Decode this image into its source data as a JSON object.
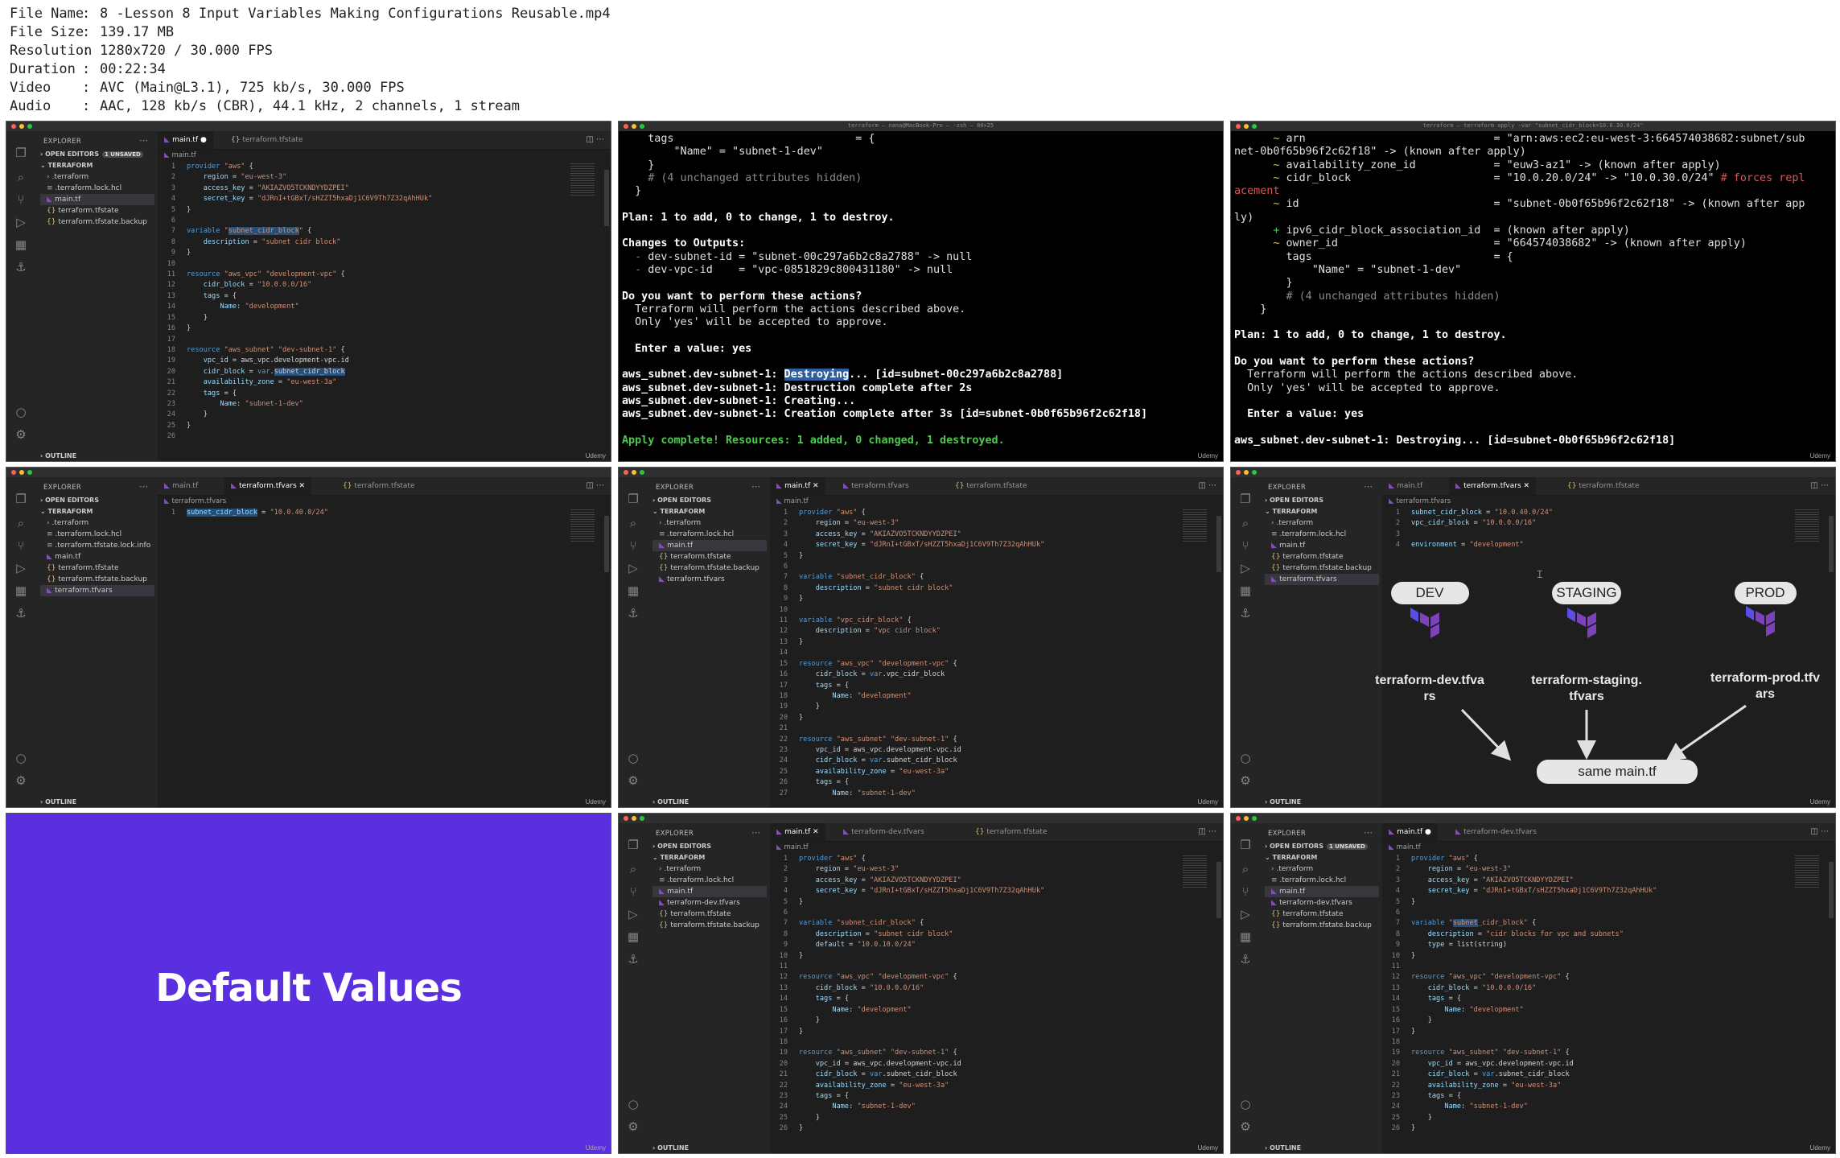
{
  "meta": [
    {
      "key": "File Name",
      "value": "8 -Lesson 8 Input Variables Making Configurations Reusable.mp4"
    },
    {
      "key": "File Size",
      "value": "139.17 MB"
    },
    {
      "key": "Resolution",
      "value": "1280x720 / 30.000 FPS"
    },
    {
      "key": "Duration",
      "value": "00:22:34"
    },
    {
      "key": "Video",
      "value": "AVC (Main@L3.1), 725 kb/s, 30.000 FPS"
    },
    {
      "key": "Audio",
      "value": "AAC, 128 kb/s (CBR), 44.1 kHz, 2 channels, 1 stream"
    }
  ],
  "watermark": "Udemy",
  "sidebar": {
    "explorer": "EXPLORER",
    "open_editors": "OPEN EDITORS",
    "unsaved": "1 UNSAVED",
    "project": "TERRAFORM",
    "outline": "OUTLINE"
  },
  "tile1": {
    "tabs": [
      "main.tf",
      "terraform.tfstate"
    ],
    "crumb": "main.tf",
    "files": [
      ".terraform",
      ".terraform.lock.hcl",
      "main.tf",
      "terraform.tfstate",
      "terraform.tfstate.backup"
    ],
    "code": [
      "provider \"aws\" {",
      "    region = \"eu-west-3\"",
      "    access_key = \"AKIAZVO5TCKNDYYDZPEI\"",
      "    secret_key = \"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\"",
      "}",
      "",
      "variable \"subnet_cidr_block\" {",
      "    description = \"subnet cidr block\"",
      "}",
      "",
      "resource \"aws_vpc\" \"development-vpc\" {",
      "    cidr_block = \"10.0.0.0/16\"",
      "    tags = {",
      "        Name: \"development\"",
      "    }",
      "}",
      "",
      "resource \"aws_subnet\" \"dev-subnet-1\" {",
      "    vpc_id = aws_vpc.development-vpc.id",
      "    cidr_block = var.subnet_cidr_block",
      "    availability_zone = \"eu-west-3a\"",
      "    tags = {",
      "        Name: \"subnet-1-dev\"",
      "    }",
      "}",
      ""
    ]
  },
  "tile2": {
    "title": "terraform — nana@MacBook-Pro — -zsh — 80×25",
    "lines": [
      "    tags                            = {",
      "        \"Name\" = \"subnet-1-dev\"",
      "    }",
      "    # (4 unchanged attributes hidden)",
      "  }",
      "",
      "Plan: 1 to add, 0 to change, 1 to destroy.",
      "",
      "Changes to Outputs:",
      "  - dev-subnet-id = \"subnet-00c297a6b2c8a2788\" -> null",
      "  - dev-vpc-id    = \"vpc-0851829c800431180\" -> null",
      "",
      "Do you want to perform these actions?",
      "  Terraform will perform the actions described above.",
      "  Only 'yes' will be accepted to approve.",
      "",
      "  Enter a value: yes",
      "",
      "aws_subnet.dev-subnet-1: Destroying... [id=subnet-00c297a6b2c8a2788]",
      "aws_subnet.dev-subnet-1: Destruction complete after 2s",
      "aws_subnet.dev-subnet-1: Creating...",
      "aws_subnet.dev-subnet-1: Creation complete after 3s [id=subnet-0b0f65b96f2c62f18]",
      "",
      "Apply complete! Resources: 1 added, 0 changed, 1 destroyed."
    ]
  },
  "tile3": {
    "title": "terraform — terraform apply -var \"subnet_cidr_block=10.0.30.0/24\"",
    "lines": [
      "      ~ arn                             = \"arn:aws:ec2:eu-west-3:664574038682:subnet/sub",
      "net-0b0f65b96f2c62f18\" -> (known after apply)",
      "      ~ availability_zone_id            = \"euw3-az1\" -> (known after apply)",
      "      ~ cidr_block                      = \"10.0.20.0/24\" -> \"10.0.30.0/24\" # forces repl",
      "acement",
      "      ~ id                              = \"subnet-0b0f65b96f2c62f18\" -> (known after app",
      "ly)",
      "      + ipv6_cidr_block_association_id  = (known after apply)",
      "      ~ owner_id                        = \"664574038682\" -> (known after apply)",
      "        tags                            = {",
      "            \"Name\" = \"subnet-1-dev\"",
      "        }",
      "        # (4 unchanged attributes hidden)",
      "    }",
      "",
      "Plan: 1 to add, 0 to change, 1 to destroy.",
      "",
      "Do you want to perform these actions?",
      "  Terraform will perform the actions described above.",
      "  Only 'yes' will be accepted to approve.",
      "",
      "  Enter a value: yes",
      "",
      "aws_subnet.dev-subnet-1: Destroying... [id=subnet-0b0f65b96f2c62f18]"
    ]
  },
  "tile4": {
    "tabs": [
      "main.tf",
      "terraform.tfvars",
      "terraform.tfstate"
    ],
    "crumb": "terraform.tfvars",
    "files": [
      ".terraform",
      ".terraform.lock.hcl",
      ".terraform.tfstate.lock.info",
      "main.tf",
      "terraform.tfstate",
      "terraform.tfstate.backup",
      "terraform.tfvars"
    ],
    "code": [
      "subnet_cidr_block = \"10.0.40.0/24\""
    ]
  },
  "tile5": {
    "tabs": [
      "main.tf",
      "terraform.tfvars",
      "terraform.tfstate"
    ],
    "crumb": "main.tf",
    "files": [
      ".terraform",
      ".terraform.lock.hcl",
      "main.tf",
      "terraform.tfstate",
      "terraform.tfstate.backup",
      "terraform.tfvars"
    ],
    "code": [
      "provider \"aws\" {",
      "    region = \"eu-west-3\"",
      "    access_key = \"AKIAZVO5TCKNDYYDZPEI\"",
      "    secret_key = \"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\"",
      "}",
      "",
      "variable \"subnet_cidr_block\" {",
      "    description = \"subnet cidr block\"",
      "}",
      "",
      "variable \"vpc_cidr_block\" {",
      "    description = \"vpc cidr block\"",
      "}",
      "",
      "resource \"aws_vpc\" \"development-vpc\" {",
      "    cidr_block = var.vpc_cidr_block",
      "    tags = {",
      "        Name: \"development\"",
      "    }",
      "}",
      "",
      "resource \"aws_subnet\" \"dev-subnet-1\" {",
      "    vpc_id = aws_vpc.development-vpc.id",
      "    cidr_block = var.subnet_cidr_block",
      "    availability_zone = \"eu-west-3a\"",
      "    tags = {",
      "        Name: \"subnet-1-dev\""
    ]
  },
  "tile6": {
    "tabs": [
      "main.tf",
      "terraform.tfvars",
      "terraform.tfstate"
    ],
    "crumb": "terraform.tfvars",
    "files": [
      ".terraform",
      ".terraform.lock.hcl",
      "main.tf",
      "terraform.tfstate",
      "terraform.tfstate.backup",
      "terraform.tfvars"
    ],
    "code": [
      "subnet_cidr_block = \"10.0.40.0/24\"",
      "vpc_cidr_block = \"10.0.0.0/16\"",
      "",
      "environment = \"development\""
    ],
    "diagram": {
      "envs": [
        "DEV",
        "STAGING",
        "PROD"
      ],
      "files": [
        "terraform-dev.tfvars",
        "terraform-staging.tfvars",
        "terraform-prod.tfvars"
      ],
      "target": "same main.tf"
    }
  },
  "tile7": {
    "title": "Default Values"
  },
  "tile8": {
    "tabs": [
      "main.tf",
      "terraform-dev.tfvars",
      "terraform.tfstate"
    ],
    "crumb": "main.tf",
    "files": [
      ".terraform",
      ".terraform.lock.hcl",
      "main.tf",
      "terraform-dev.tfvars",
      "terraform.tfstate",
      "terraform.tfstate.backup"
    ],
    "code": [
      "provider \"aws\" {",
      "    region = \"eu-west-3\"",
      "    access_key = \"AKIAZVO5TCKNDYYDZPEI\"",
      "    secret_key = \"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\"",
      "}",
      "",
      "variable \"subnet_cidr_block\" {",
      "    description = \"subnet cidr block\"",
      "    default = \"10.0.10.0/24\"",
      "}",
      "",
      "resource \"aws_vpc\" \"development-vpc\" {",
      "    cidr_block = \"10.0.0.0/16\"",
      "    tags = {",
      "        Name: \"development\"",
      "    }",
      "}",
      "",
      "resource \"aws_subnet\" \"dev-subnet-1\" {",
      "    vpc_id = aws_vpc.development-vpc.id",
      "    cidr_block = var.subnet_cidr_block",
      "    availability_zone = \"eu-west-3a\"",
      "    tags = {",
      "        Name: \"subnet-1-dev\"",
      "    }",
      "}"
    ]
  },
  "tile9": {
    "tabs": [
      "main.tf",
      "terraform-dev.tfvars"
    ],
    "crumb": "main.tf",
    "files": [
      ".terraform",
      ".terraform.lock.hcl",
      "main.tf",
      "terraform-dev.tfvars",
      "terraform.tfstate",
      "terraform.tfstate.backup"
    ],
    "code": [
      "provider \"aws\" {",
      "    region = \"eu-west-3\"",
      "    access_key = \"AKIAZVO5TCKNDYYDZPEI\"",
      "    secret_key = \"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\"",
      "}",
      "",
      "variable \"subnet_cidr_block\" {",
      "    description = \"cidr blocks for vpc and subnets\"",
      "    type = list(string)",
      "}",
      "",
      "resource \"aws_vpc\" \"development-vpc\" {",
      "    cidr_block = \"10.0.0.0/16\"",
      "    tags = {",
      "        Name: \"development\"",
      "    }",
      "}",
      "",
      "resource \"aws_subnet\" \"dev-subnet-1\" {",
      "    vpc_id = aws_vpc.development-vpc.id",
      "    cidr_block = var.subnet_cidr_block",
      "    availability_zone = \"eu-west-3a\"",
      "    tags = {",
      "        Name: \"subnet-1-dev\"",
      "    }",
      "}"
    ]
  }
}
